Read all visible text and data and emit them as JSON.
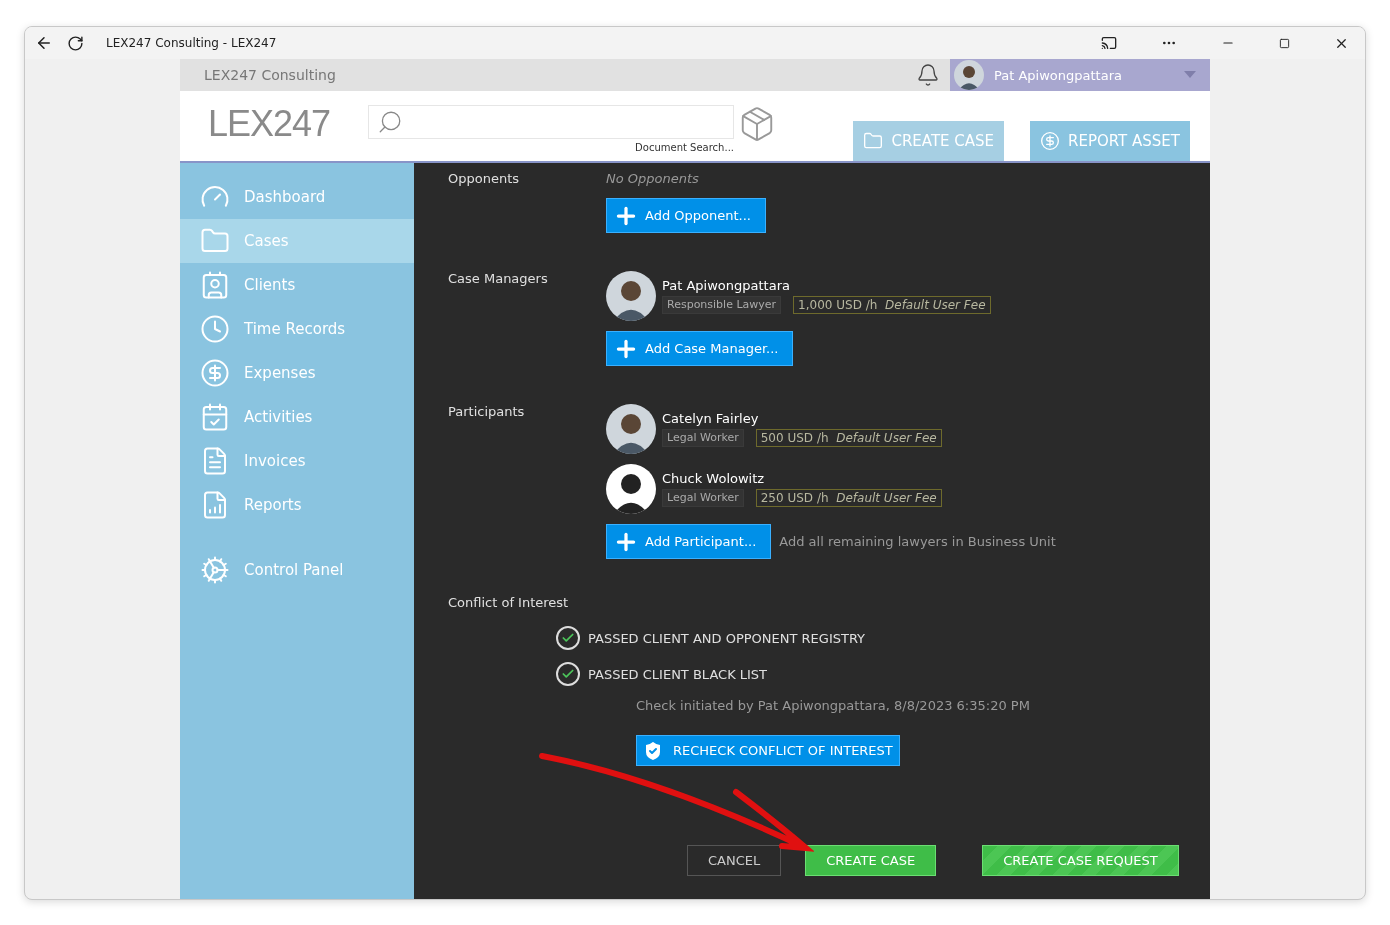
{
  "window": {
    "title": "LEX247 Consulting - LEX247"
  },
  "app": {
    "org": "LEX247 Consulting",
    "user": "Pat Apiwongpattara",
    "logo": "LEX247",
    "search": {
      "caption": "Document Search..."
    },
    "header_buttons": [
      {
        "label": "CREATE CASE",
        "disabled": true
      },
      {
        "label": "REPORT ASSET",
        "disabled": false
      }
    ]
  },
  "sidebar": {
    "items": [
      {
        "label": "Dashboard",
        "selected": false
      },
      {
        "label": "Cases",
        "selected": true
      },
      {
        "label": "Clients",
        "selected": false
      },
      {
        "label": "Time Records",
        "selected": false
      },
      {
        "label": "Expenses",
        "selected": false
      },
      {
        "label": "Activities",
        "selected": false
      },
      {
        "label": "Invoices",
        "selected": false
      },
      {
        "label": "Reports",
        "selected": false
      },
      {
        "label": "Control Panel",
        "selected": false
      }
    ]
  },
  "opponents": {
    "label": "Opponents",
    "empty": "No Opponents",
    "add": "Add Opponent..."
  },
  "case_managers": {
    "label": "Case Managers",
    "people": [
      {
        "name": "Pat Apiwongpattara",
        "role": "Responsible Lawyer",
        "rate": "1,000 USD /h",
        "fee": "Default User Fee"
      }
    ],
    "add": "Add Case Manager..."
  },
  "participants": {
    "label": "Participants",
    "people": [
      {
        "name": "Catelyn Fairley",
        "role": "Legal Worker",
        "rate": "500 USD /h",
        "fee": "Default User Fee"
      },
      {
        "name": "Chuck Wolowitz",
        "role": "Legal Worker",
        "rate": "250 USD /h",
        "fee": "Default User Fee"
      }
    ],
    "add": "Add Participant...",
    "add_all": "Add all remaining lawyers in Business Unit"
  },
  "conflict": {
    "label": "Conflict of Interest",
    "checks": [
      {
        "text": "PASSED CLIENT AND OPPONENT REGISTRY",
        "passed": true
      },
      {
        "text": "PASSED CLIENT BLACK LIST",
        "passed": true
      }
    ],
    "initiated": "Check initiated by Pat Apiwongpattara, 8/8/2023 6:35:20 PM",
    "recheck": "RECHECK CONFLICT OF INTEREST"
  },
  "actions": [
    {
      "label": "CANCEL",
      "kind": "outline"
    },
    {
      "label": "CREATE CASE",
      "kind": "primary"
    },
    {
      "label": "CREATE CASE REQUEST",
      "kind": "striped"
    }
  ]
}
